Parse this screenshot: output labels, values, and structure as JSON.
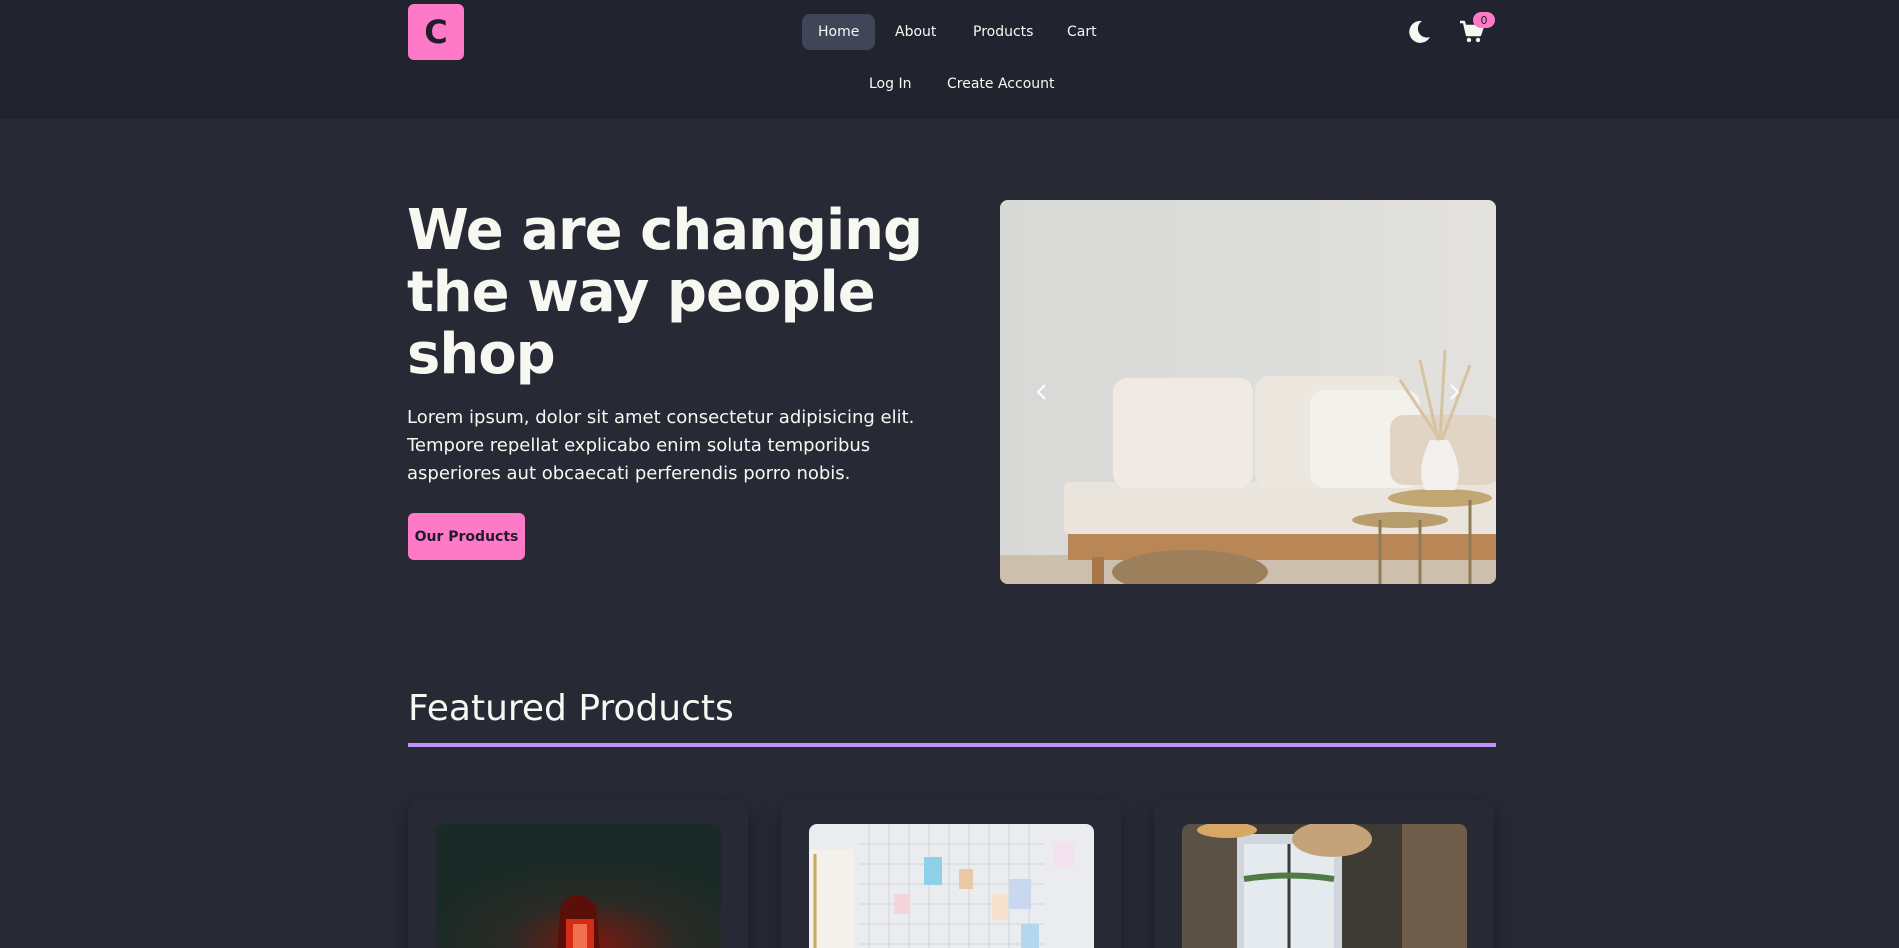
{
  "header": {
    "logo": "C",
    "nav": [
      "Home",
      "About",
      "Products",
      "Cart"
    ],
    "nav_secondary": [
      "Log In",
      "Create Account"
    ],
    "cart_count": "0",
    "theme_icon": "moon-icon",
    "cart_icon": "cart-icon"
  },
  "hero": {
    "title": "We are changing the way people shop",
    "text": "Lorem ipsum, dolor sit amet consectetur adipisicing elit. Tempore repellat explicabo enim soluta temporibus asperiores aut obcaecati perferendis porro nobis.",
    "button": "Our Products"
  },
  "featured": {
    "title": "Featured Products"
  },
  "colors": {
    "background": "#272935",
    "header_bg": "#21232e",
    "accent_pink": "#ff7ac6",
    "accent_purple": "#bd93f9",
    "text": "#f8f8f2"
  }
}
